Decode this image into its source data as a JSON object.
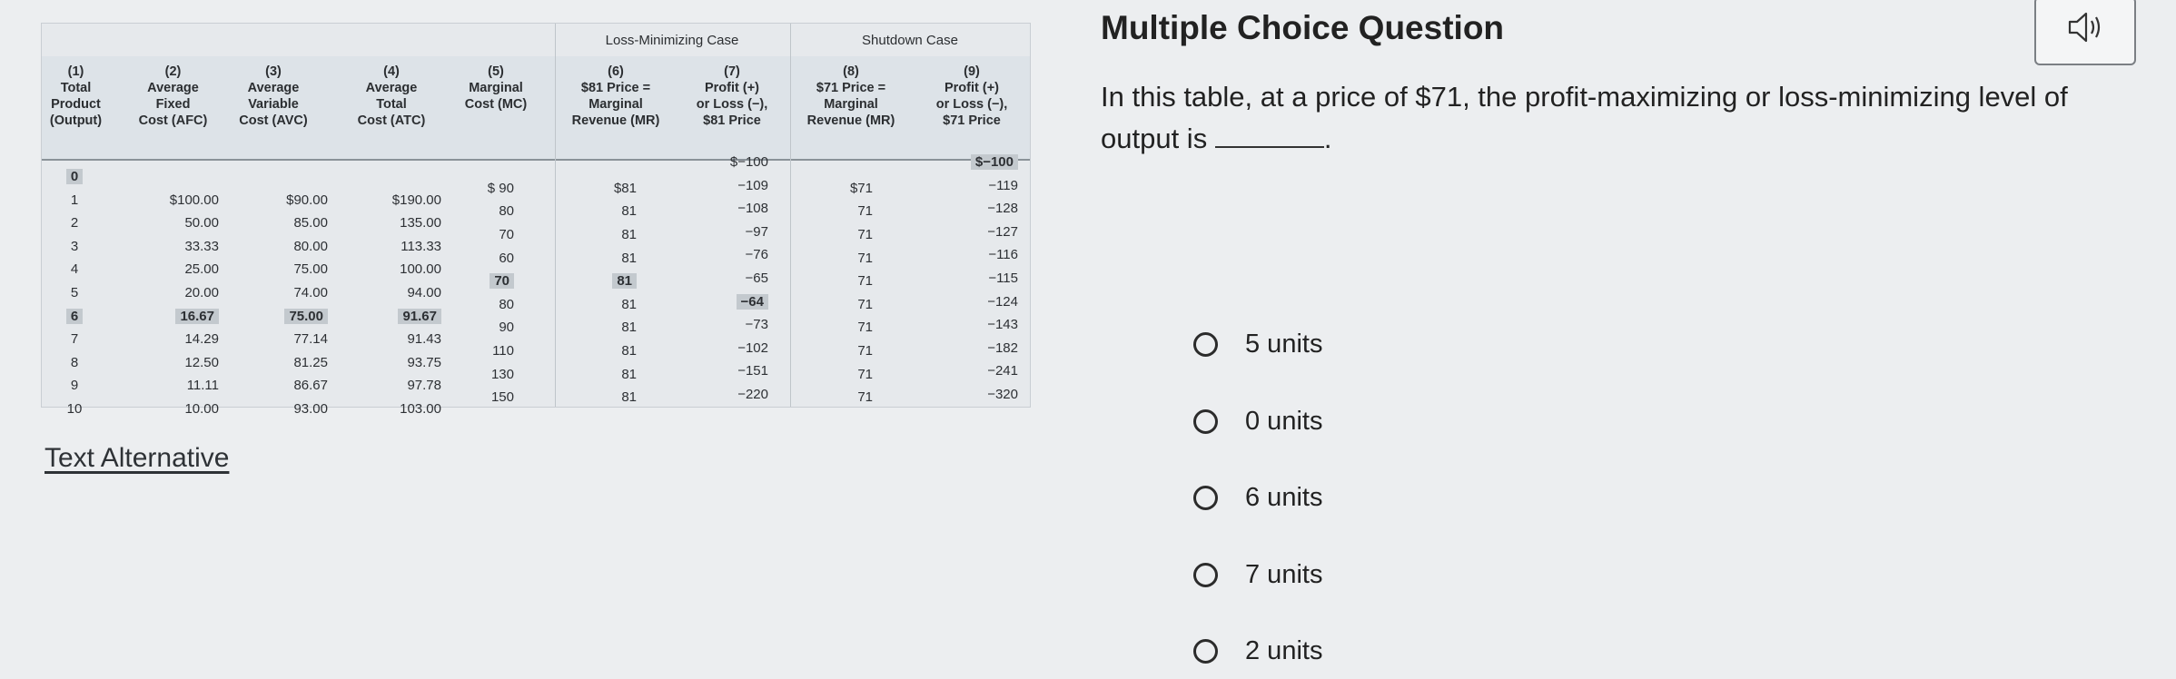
{
  "table": {
    "groups": {
      "loss": "Loss-Minimizing Case",
      "shutdown": "Shutdown Case"
    },
    "headers": [
      "(1)\nTotal\nProduct\n(Output)",
      "(2)\nAverage\nFixed\nCost (AFC)",
      "(3)\nAverage\nVariable\nCost (AVC)",
      "(4)\nAverage\nTotal\nCost (ATC)",
      "(5)\nMarginal\nCost (MC)",
      "(6)\n$81 Price =\nMarginal\nRevenue (MR)",
      "(7)\nProfit (+)\nor Loss (−),\n$81 Price",
      "(8)\n$71 Price =\nMarginal\nRevenue (MR)",
      "(9)\nProfit (+)\nor Loss (−),\n$71 Price"
    ],
    "output": [
      "0",
      "1",
      "2",
      "3",
      "4",
      "5",
      "6",
      "7",
      "8",
      "9",
      "10"
    ],
    "afc": [
      "$100.00",
      "50.00",
      "33.33",
      "25.00",
      "20.00",
      "16.67",
      "14.29",
      "12.50",
      "11.11",
      "10.00"
    ],
    "avc": [
      "$90.00",
      "85.00",
      "80.00",
      "75.00",
      "74.00",
      "75.00",
      "77.14",
      "81.25",
      "86.67",
      "93.00"
    ],
    "atc": [
      "$190.00",
      "135.00",
      "113.33",
      "100.00",
      "94.00",
      "91.67",
      "91.43",
      "93.75",
      "97.78",
      "103.00"
    ],
    "mc": [
      "$ 90",
      "80",
      "70",
      "60",
      "70",
      "80",
      "90",
      "110",
      "130",
      "150"
    ],
    "mr81": [
      "$81",
      "81",
      "81",
      "81",
      "81",
      "81",
      "81",
      "81",
      "81",
      "81"
    ],
    "profit81": [
      "$−100",
      "−109",
      "−108",
      "−97",
      "−76",
      "−65",
      "−64",
      "−73",
      "−102",
      "−151",
      "−220"
    ],
    "mr71": [
      "$71",
      "71",
      "71",
      "71",
      "71",
      "71",
      "71",
      "71",
      "71",
      "71"
    ],
    "profit71": [
      "$−100",
      "−119",
      "−128",
      "−127",
      "−116",
      "−115",
      "−124",
      "−143",
      "−182",
      "−241",
      "−320"
    ]
  },
  "text_alternative_label": "Text Alternative",
  "question": {
    "title": "Multiple Choice Question",
    "text": "In this table, at a price of $71, the profit-maximizing or loss-minimizing level of output is",
    "tail": ".",
    "audio_icon": "speaker-icon",
    "options": [
      "5 units",
      "0 units",
      "6 units",
      "7 units",
      "2 units"
    ]
  }
}
